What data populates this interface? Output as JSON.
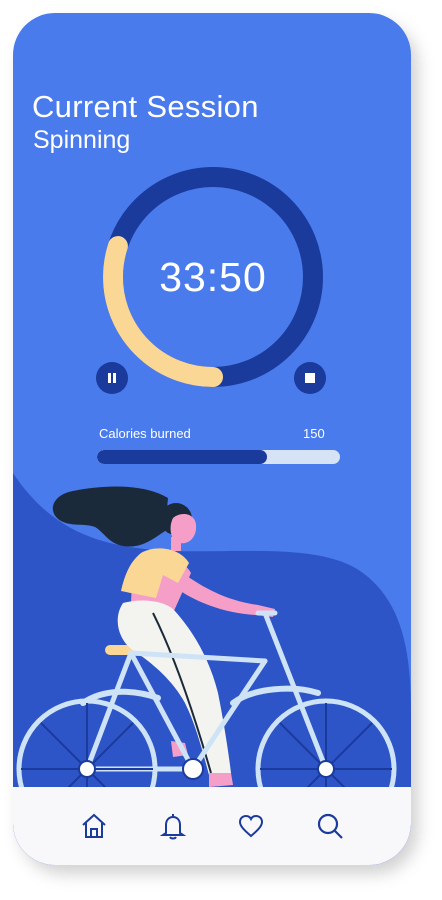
{
  "session": {
    "title": "Current Session",
    "activity": "Spinning"
  },
  "timer": {
    "display": "33:50",
    "progress_fraction": 0.3
  },
  "controls": {
    "pause_icon": "pause-icon",
    "stop_icon": "stop-icon"
  },
  "calories": {
    "label": "Calories burned",
    "value": "150",
    "progress_fraction": 0.7
  },
  "nav": {
    "items": [
      {
        "icon": "home-icon"
      },
      {
        "icon": "bell-icon"
      },
      {
        "icon": "heart-icon"
      },
      {
        "icon": "search-icon"
      }
    ]
  },
  "colors": {
    "background": "#4a7bec",
    "dark_blue": "#1a3a9c",
    "accent_yellow": "#fbd796",
    "track_light": "#d5e3f5",
    "nav_bg": "#f8f8fb"
  }
}
